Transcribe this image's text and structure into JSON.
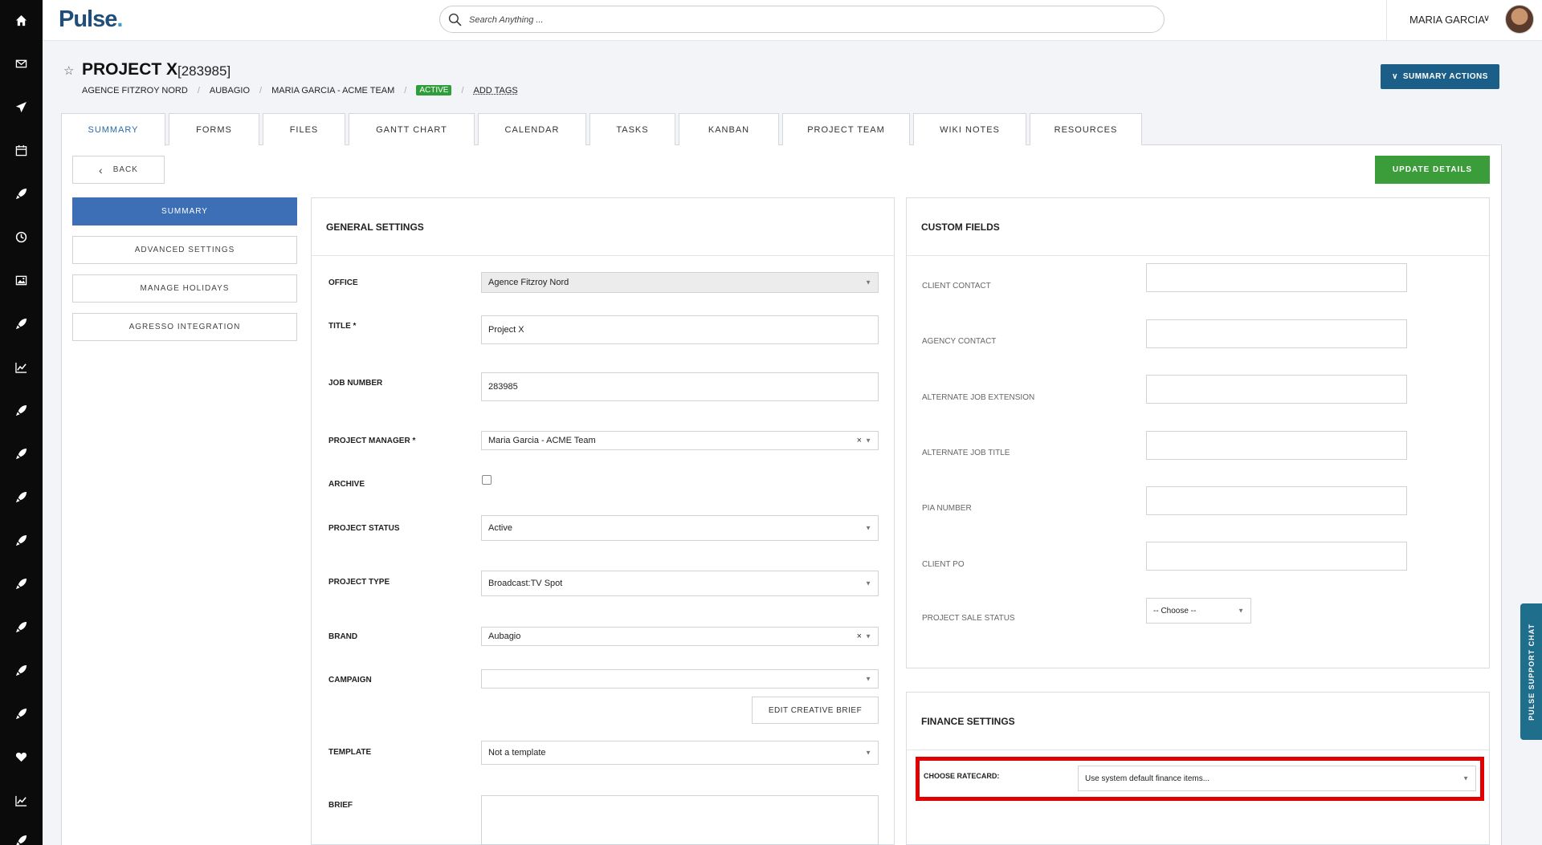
{
  "app": {
    "logo": "Pulse",
    "logo_dot": "."
  },
  "search": {
    "placeholder": "Search Anything ..."
  },
  "user": {
    "name": "MARIA GARCIA"
  },
  "project": {
    "title": "PROJECT X",
    "number": "[283985]",
    "breadcrumb": [
      "AGENCE FITZROY NORD",
      "AUBAGIO",
      "MARIA GARCIA - ACME TEAM"
    ],
    "status": "ACTIVE",
    "add_tags": "ADD TAGS",
    "summary_actions": "SUMMARY ACTIONS"
  },
  "tabs": [
    "SUMMARY",
    "FORMS",
    "FILES",
    "GANTT CHART",
    "CALENDAR",
    "TASKS",
    "KANBAN",
    "PROJECT TEAM",
    "WIKI NOTES",
    "RESOURCES"
  ],
  "back_label": "BACK",
  "update_label": "UPDATE DETAILS",
  "side_nav": [
    "SUMMARY",
    "ADVANCED SETTINGS",
    "MANAGE HOLIDAYS",
    "AGRESSO INTEGRATION"
  ],
  "general": {
    "heading": "GENERAL SETTINGS",
    "office_label": "OFFICE",
    "office_value": "Agence Fitzroy Nord",
    "title_label": "TITLE *",
    "title_value": "Project X",
    "job_label": "JOB NUMBER",
    "job_value": "283985",
    "pm_label": "PROJECT MANAGER *",
    "pm_value": "Maria Garcia - ACME Team",
    "archive_label": "ARCHIVE",
    "status_label": "PROJECT STATUS",
    "status_value": "Active",
    "type_label": "PROJECT TYPE",
    "type_value": "Broadcast:TV Spot",
    "brand_label": "BRAND",
    "brand_value": "Aubagio",
    "campaign_label": "CAMPAIGN",
    "campaign_value": "",
    "edit_brief": "EDIT CREATIVE BRIEF",
    "template_label": "TEMPLATE",
    "template_value": "Not a template",
    "brief_label": "BRIEF"
  },
  "custom": {
    "heading": "CUSTOM FIELDS",
    "fields": [
      "CLIENT CONTACT",
      "AGENCY CONTACT",
      "ALTERNATE JOB EXTENSION",
      "ALTERNATE JOB TITLE",
      "PIA NUMBER",
      "CLIENT PO"
    ],
    "sale_status_label": "PROJECT SALE STATUS",
    "sale_status_value": "-- Choose --"
  },
  "finance": {
    "heading": "FINANCE SETTINGS",
    "ratecard_label": "CHOOSE RATECARD:",
    "ratecard_value": "Use system default finance items..."
  },
  "support_chat": "PULSE SUPPORT CHAT",
  "colors": {
    "brand_blue": "#1b5f88",
    "active_nav": "#3c6fb6",
    "update_green": "#3a9d3a",
    "status_green": "#2f9e3a",
    "highlight_red": "#e00000"
  },
  "rail_icons": [
    "home-icon",
    "mail-icon",
    "send-icon",
    "calendar-icon",
    "rocket-icon",
    "clock-icon",
    "image-icon",
    "rocket-icon",
    "chart-icon",
    "rocket-icon",
    "rocket-icon",
    "rocket-icon",
    "rocket-icon",
    "rocket-icon",
    "rocket-icon",
    "rocket-icon",
    "rocket-icon",
    "heart-icon",
    "chart-icon",
    "rocket-icon"
  ]
}
